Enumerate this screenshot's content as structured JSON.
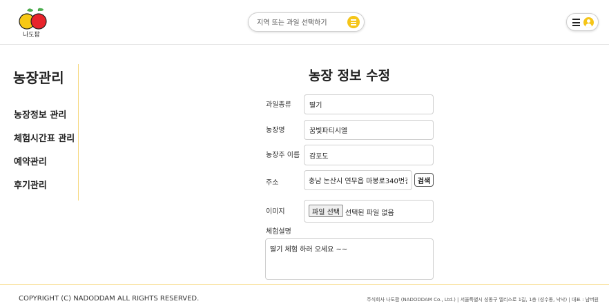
{
  "header": {
    "logo_text": "나도팜",
    "search_placeholder": "지역 또는 과일 선택하기",
    "search_icon": "menu-lines-icon",
    "menu_icon": "hamburger-icon",
    "user_icon": "user-circle-icon"
  },
  "sidebar": {
    "title": "농장관리",
    "items": [
      {
        "label": "농장정보 관리"
      },
      {
        "label": "체험시간표 관리"
      },
      {
        "label": "예약관리"
      },
      {
        "label": "후기관리"
      }
    ]
  },
  "form": {
    "title": "농장 정보 수정",
    "fields": {
      "fruit_type": {
        "label": "과일종류",
        "value": "딸기"
      },
      "farm_name": {
        "label": "농장명",
        "value": "꿈빛파티시엘"
      },
      "owner_name": {
        "label": "농장주 이름",
        "value": "감포도"
      },
      "address": {
        "label": "주소",
        "value": "충남 논산시 연무읍 마봉로340번길",
        "button": "검색"
      },
      "image": {
        "label": "이미지",
        "button": "파일 선택",
        "status": "선택된 파일 없음"
      },
      "description": {
        "label": "체험설명",
        "value": "딸기 체험 하러 오세요 ~~"
      }
    }
  },
  "footer": {
    "copyright": "COPYRIGHT (C) NADODDAM ALL RIGHTS RESERVED.",
    "company": "주식회사 나도팜 (NADODDAM Co., Ltd.) | 서울특별시 성동구 엘리스로 1길, 1층 (성수동, 낙낙) | 대표 : 냠버원"
  },
  "colors": {
    "accent": "#f5c518",
    "divider": "#f6d77c",
    "logo_red": "#e8242b",
    "logo_yellow": "#f7c815"
  }
}
